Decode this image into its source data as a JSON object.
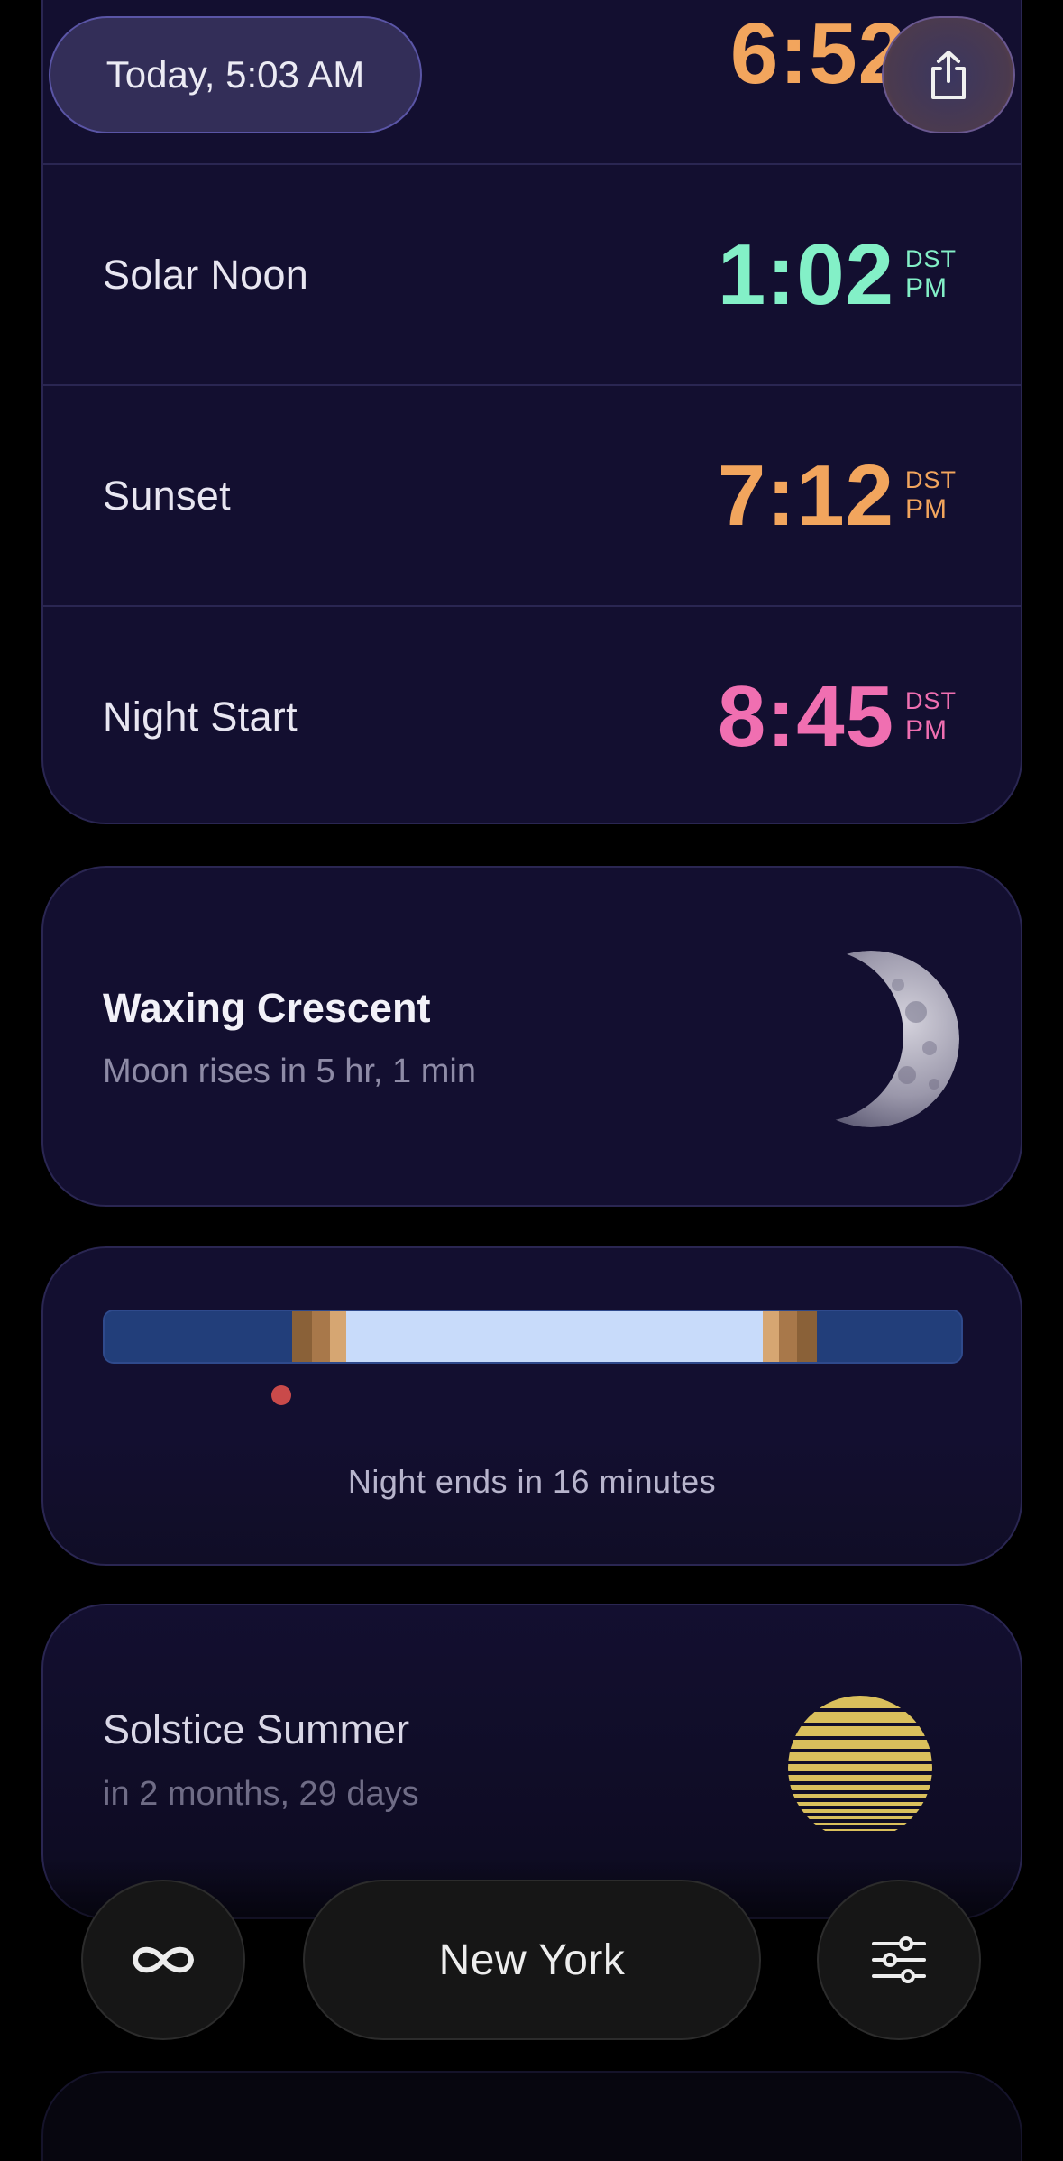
{
  "header": {
    "date_label": "Today, 5:03 AM",
    "share_icon": "share-icon"
  },
  "times": [
    {
      "label": "",
      "time": "6:52",
      "dst": "",
      "ampm": "",
      "color": "#f2a55d"
    },
    {
      "label": "Solar Noon",
      "time": "1:02",
      "dst": "DST",
      "ampm": "PM",
      "color": "#83f0c7"
    },
    {
      "label": "Sunset",
      "time": "7:12",
      "dst": "DST",
      "ampm": "PM",
      "color": "#f2a55d"
    },
    {
      "label": "Night Start",
      "time": "8:45",
      "dst": "DST",
      "ampm": "PM",
      "color": "#f06fb1"
    }
  ],
  "moon": {
    "phase": "Waxing Crescent",
    "subtitle": "Moon rises in 5 hr, 1 min",
    "icon": "moon-crescent-icon"
  },
  "daylight_bar": {
    "caption": "Night ends in 16 minutes",
    "now_fraction": 0.21,
    "colors": {
      "night": "#223e7a",
      "twilight_dark": "#8a6138",
      "twilight_mid": "#a8784a",
      "twilight_light": "#d6a672",
      "day": "#c8dbfa",
      "now_dot": "#c94a4a"
    }
  },
  "solstice": {
    "title": "Solstice Summer",
    "subtitle": "in 2 months, 29 days",
    "icon": "sun-striped-icon",
    "color": "#d9bf5c"
  },
  "bottom_bar": {
    "left_icon": "infinity-icon",
    "location": "New York",
    "right_icon": "sliders-icon"
  }
}
